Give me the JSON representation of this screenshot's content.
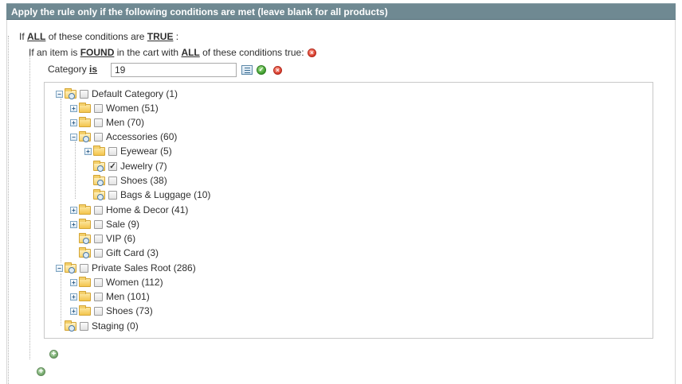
{
  "header": {
    "title": "Apply the rule only if the following conditions are met (leave blank for all products)"
  },
  "condition_line_1": {
    "prefix": "If",
    "aggregator": "ALL",
    "middle": "of these conditions are",
    "value": "TRUE",
    "suffix": ":"
  },
  "condition_line_2": {
    "prefix": "If an item is",
    "found": "FOUND",
    "middle": "in the cart with",
    "aggregator": "ALL",
    "suffix": "of these conditions true:"
  },
  "category_condition": {
    "attribute": "Category",
    "operator": "is",
    "value": "19"
  },
  "tree": [
    {
      "label": "Default Category (1)",
      "checked": false
    },
    {
      "label": "Women (51)",
      "checked": false
    },
    {
      "label": "Men (70)",
      "checked": false
    },
    {
      "label": "Accessories (60)",
      "checked": false
    },
    {
      "label": "Eyewear (5)",
      "checked": false
    },
    {
      "label": "Jewelry (7)",
      "checked": true
    },
    {
      "label": "Shoes (38)",
      "checked": false
    },
    {
      "label": "Bags & Luggage (10)",
      "checked": false
    },
    {
      "label": "Home & Decor (41)",
      "checked": false
    },
    {
      "label": "Sale (9)",
      "checked": false
    },
    {
      "label": "VIP (6)",
      "checked": false
    },
    {
      "label": "Gift Card (3)",
      "checked": false
    },
    {
      "label": "Private Sales Root (286)",
      "checked": false
    },
    {
      "label": "Women (112)",
      "checked": false
    },
    {
      "label": "Men (101)",
      "checked": false
    },
    {
      "label": "Shoes (73)",
      "checked": false
    },
    {
      "label": "Staging (0)",
      "checked": false
    }
  ],
  "icons": {
    "remove": "remove-icon",
    "apply": "apply-icon",
    "chooser": "chooser-list-icon",
    "add": "add-condition-icon",
    "folder": "folder-icon",
    "expander": "tree-expander-icon",
    "checkbox": "checkbox"
  },
  "colors": {
    "header_bg": "#6f8992",
    "remove_red": "#d63a2a",
    "apply_green": "#3a9a2a",
    "add_green": "#6fa467"
  }
}
